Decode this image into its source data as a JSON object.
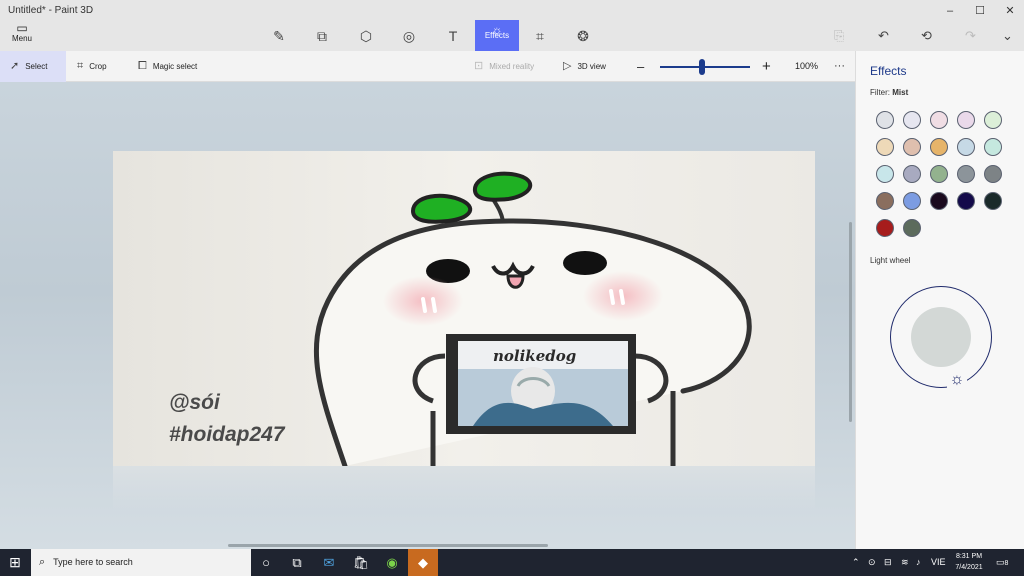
{
  "app": {
    "title": "Untitled* - Paint 3D"
  },
  "window_controls": {
    "minimize": "–",
    "maximize": "☐",
    "close": "✕"
  },
  "menu": {
    "label": "Menu"
  },
  "tools": {
    "active_label": "Effects"
  },
  "toolbar": {
    "select": "Select",
    "crop": "Crop",
    "magic_select": "Magic select",
    "mixed_reality": "Mixed reality",
    "view_3d": "3D view",
    "zoom_minus": "–",
    "zoom_plus": "+",
    "zoom_value": "100%",
    "zoom_level": 0.47,
    "more": "···"
  },
  "canvas": {
    "signature_line1": "@sói",
    "signature_line2": "#hoidap247",
    "panel_text": "nolikedog"
  },
  "effects_panel": {
    "title": "Effects",
    "filter_label": "Filter:",
    "filter_value": "Mist",
    "light_wheel_label": "Light wheel",
    "swatches": [
      "#dfe2e7",
      "#e6e6f0",
      "#f0dde4",
      "#ead9ea",
      "#dcefd8",
      "#eed9b8",
      "#dfbfae",
      "#e6b46a",
      "#c6d9e6",
      "#c5e8df",
      "#c8e6ea",
      "#a8aac0",
      "#93b28e",
      "#8c949a",
      "#7d8386",
      "#8a6e5e",
      "#7c9ce2",
      "#1a0a1e",
      "#140a4a",
      "#1a2a2a",
      "#a61c1c",
      "#5c6b5c"
    ]
  },
  "taskbar": {
    "search_placeholder": "Type here to search",
    "language": "VIE",
    "time": "8:31 PM",
    "date": "7/4/2021",
    "notification_count": "8"
  }
}
